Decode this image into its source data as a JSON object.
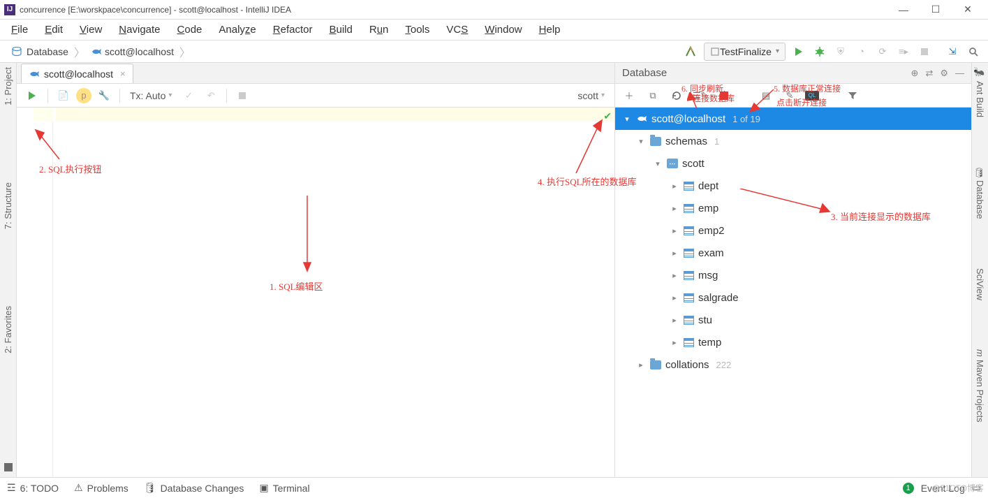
{
  "window": {
    "title": "concurrence [E:\\worskpace\\concurrence] - scott@localhost - IntelliJ IDEA"
  },
  "menu": [
    "File",
    "Edit",
    "View",
    "Navigate",
    "Code",
    "Analyze",
    "Refactor",
    "Build",
    "Run",
    "Tools",
    "VCS",
    "Window",
    "Help"
  ],
  "breadcrumb": {
    "root": "Database",
    "item": "scott@localhost"
  },
  "runcfg": {
    "name": "TestFinalize"
  },
  "tabs": {
    "active": "scott@localhost"
  },
  "editor_toolbar": {
    "tx": "Tx: Auto",
    "schema": "scott"
  },
  "database_panel": {
    "title": "Database",
    "datasource": "scott@localhost",
    "count": "1 of 19",
    "schemas_label": "schemas",
    "schemas_count": "1",
    "schema_name": "scott",
    "tables": [
      "dept",
      "emp",
      "emp2",
      "exam",
      "msg",
      "salgrade",
      "stu",
      "temp"
    ],
    "collations_label": "collations",
    "collations_count": "222"
  },
  "left_rail": [
    "1: Project",
    "7: Structure",
    "2: Favorites"
  ],
  "right_rail": [
    "Ant Build",
    "Database",
    "SciView",
    "Maven Projects"
  ],
  "status": {
    "todo": "6: TODO",
    "problems": "Problems",
    "dbchanges": "Database Changes",
    "terminal": "Terminal",
    "eventlog": "Event Log"
  },
  "annotations": {
    "a1": "1.  SQL编辑区",
    "a2": "2. SQL执行按钮",
    "a3": "3. 当前连接显示的数据库",
    "a4": "4. 执行SQL所在的数据库",
    "a5": "5. 数据库正常连接",
    "a5b": "点击断开连接",
    "a6": "6. 同步刷新,",
    "a6b": "连接数据库"
  },
  "watermark": "@51CTO博客"
}
